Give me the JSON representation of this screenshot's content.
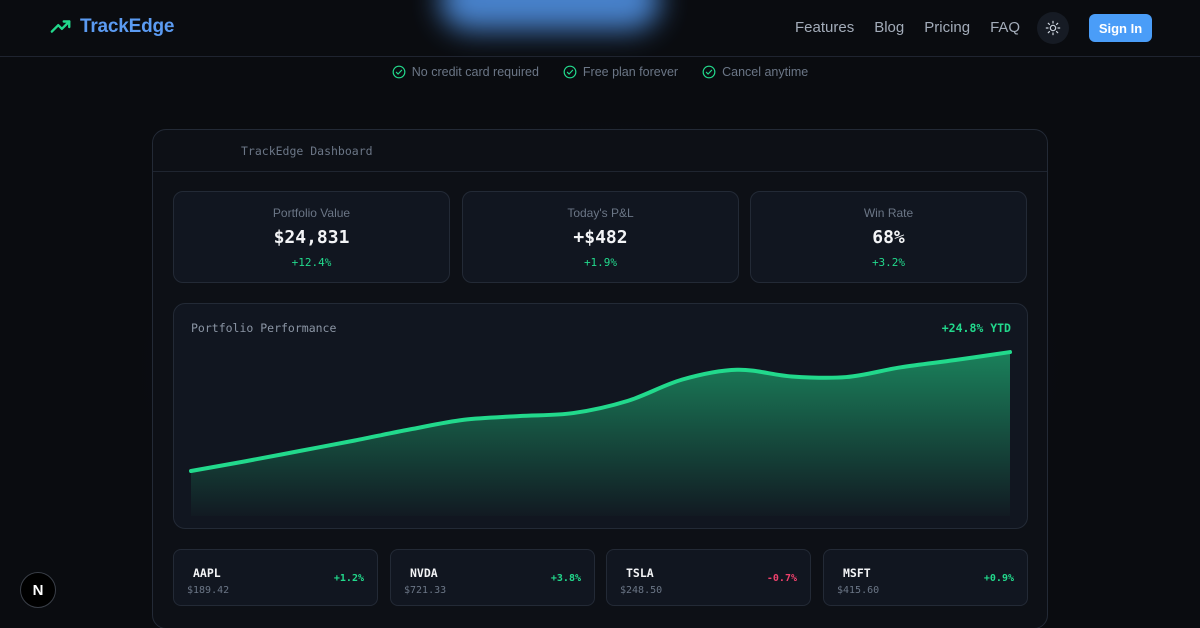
{
  "header": {
    "brand": "TrackEdge",
    "nav": [
      "Features",
      "Blog",
      "Pricing",
      "FAQ"
    ],
    "sign_in": "Sign In"
  },
  "perks": [
    "No credit card required",
    "Free plan forever",
    "Cancel anytime"
  ],
  "dashboard": {
    "title": "TrackEdge Dashboard",
    "stats": [
      {
        "label": "Portfolio Value",
        "value": "$24,831",
        "delta": "+12.4%"
      },
      {
        "label": "Today's P&L",
        "value": "+$482",
        "delta": "+1.9%"
      },
      {
        "label": "Win Rate",
        "value": "68%",
        "delta": "+3.2%"
      }
    ],
    "chart": {
      "title": "Portfolio Performance",
      "ytd": "+24.8% YTD"
    },
    "tickers": [
      {
        "symbol": "AAPL",
        "price": "$189.42",
        "change": "+1.2%",
        "direction": "up"
      },
      {
        "symbol": "NVDA",
        "price": "$721.33",
        "change": "+3.8%",
        "direction": "up"
      },
      {
        "symbol": "TSLA",
        "price": "$248.50",
        "change": "-0.7%",
        "direction": "down"
      },
      {
        "symbol": "MSFT",
        "price": "$415.60",
        "change": "+0.9%",
        "direction": "up"
      }
    ]
  },
  "colors": {
    "accent": "#22d98c",
    "brand": "#5b9bf2",
    "negative": "#f0416c",
    "button": "#4a9df8"
  },
  "chart_data": {
    "type": "area",
    "title": "Portfolio Performance",
    "x": [
      0,
      1,
      2,
      3,
      4,
      5,
      6,
      7,
      8,
      9,
      10,
      11,
      12,
      13,
      14,
      15
    ],
    "values": [
      0.0,
      1.6,
      3.3,
      5.0,
      6.8,
      8.4,
      9.0,
      9.5,
      11.5,
      15.0,
      16.6,
      15.5,
      15.4,
      17.0,
      18.2,
      19.5
    ],
    "ylim": [
      0,
      20
    ],
    "grid": false,
    "legend": "none"
  }
}
